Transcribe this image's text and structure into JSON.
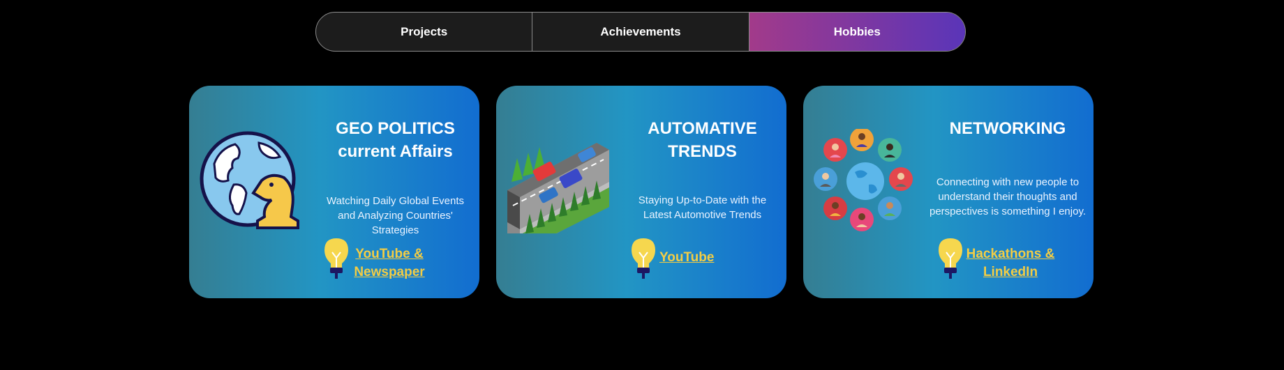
{
  "tabs": [
    {
      "label": "Projects",
      "active": false
    },
    {
      "label": "Achievements",
      "active": false
    },
    {
      "label": "Hobbies",
      "active": true
    }
  ],
  "cards": [
    {
      "icon": "globe-chess-knight-icon",
      "title_line1": "GEO POLITICS",
      "title_line2": "current Affairs",
      "description": "Watching Daily Global Events and Analyzing Countries' Strategies",
      "link_icon": "lightbulb-icon",
      "link_label": "YouTube & Newspaper"
    },
    {
      "icon": "highway-traffic-icon",
      "title_line1": "AUTOMATIVE",
      "title_line2": "TRENDS",
      "description": "Staying Up-to-Date with the Latest Automotive Trends",
      "link_icon": "lightbulb-icon",
      "link_label": "YouTube "
    },
    {
      "icon": "people-network-globe-icon",
      "title_line1": "NETWORKING",
      "title_line2": "",
      "description": "Connecting with new people to understand their thoughts and perspectives is something I enjoy.",
      "link_icon": "lightbulb-icon",
      "link_label": "Hackathons & LinkedIn"
    }
  ],
  "colors": {
    "active_tab_start": "#a23a8a",
    "active_tab_end": "#5a35b8",
    "link": "#f3cd44",
    "card_left": "#357e92",
    "card_right": "#126dd0"
  }
}
